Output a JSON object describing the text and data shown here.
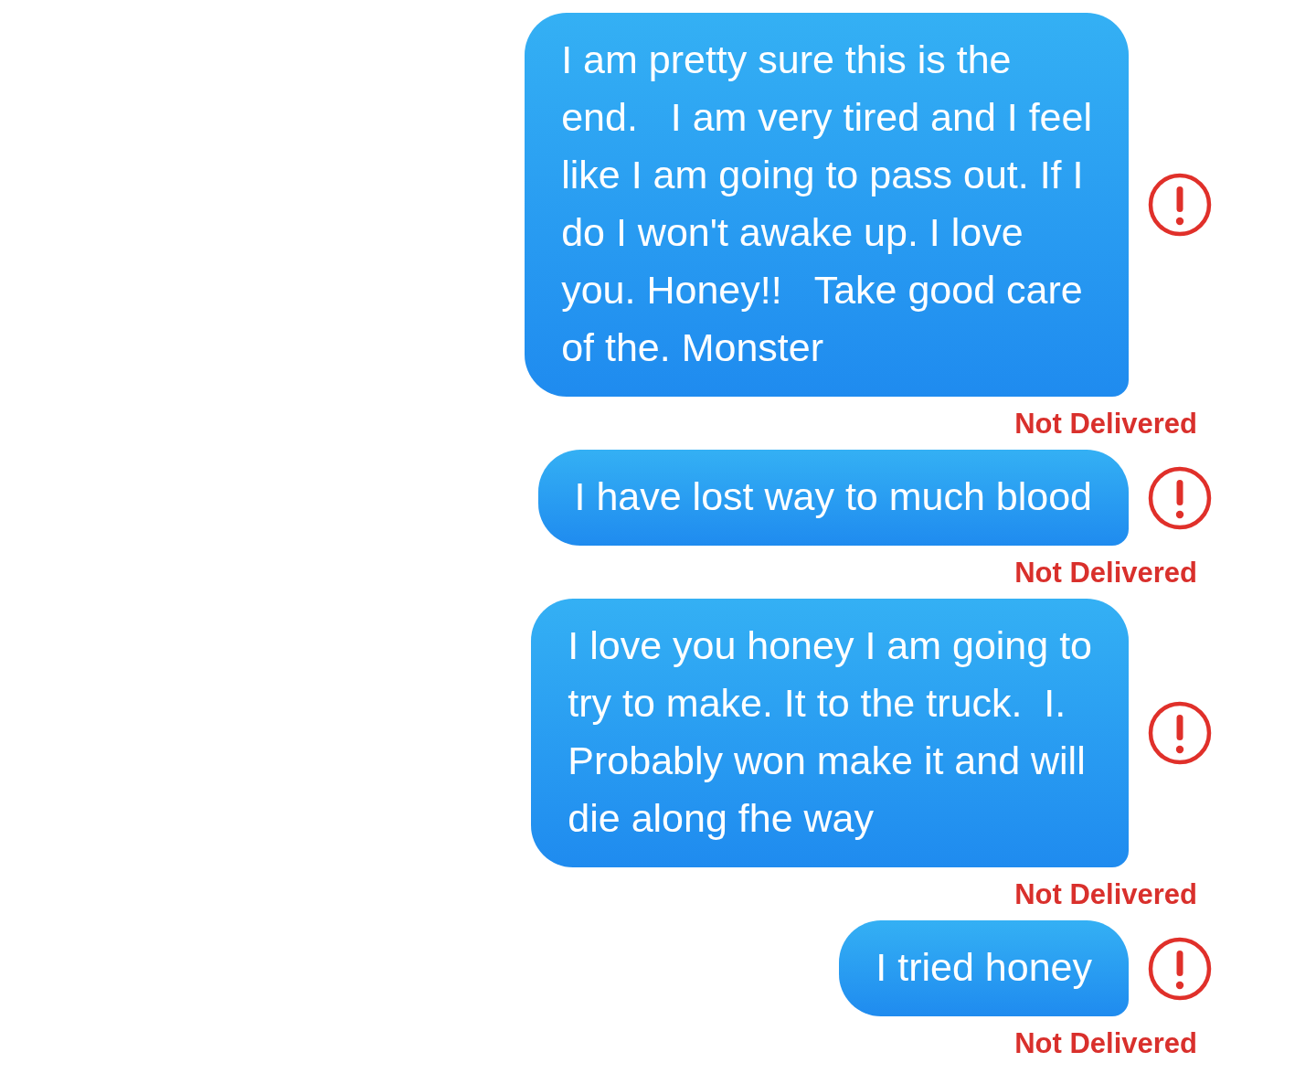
{
  "messages": [
    {
      "text": "I am pretty sure this is the\nend.   I am very tired and I feel\nlike I am going to pass out. If I\ndo I won't awake up. I love\nyou. Honey!!   Take good care\nof the. Monster",
      "failed": true,
      "status": "Not Delivered"
    },
    {
      "text": "I have lost way to much blood",
      "failed": true,
      "status": "Not Delivered"
    },
    {
      "text": "I love you honey I am going to\ntry to make. It to the truck.  I.\nProbably won make it and will\ndie along fhe way",
      "failed": true,
      "status": "Not Delivered"
    },
    {
      "text": "I tried honey",
      "failed": true,
      "status": "Not Delivered"
    }
  ]
}
